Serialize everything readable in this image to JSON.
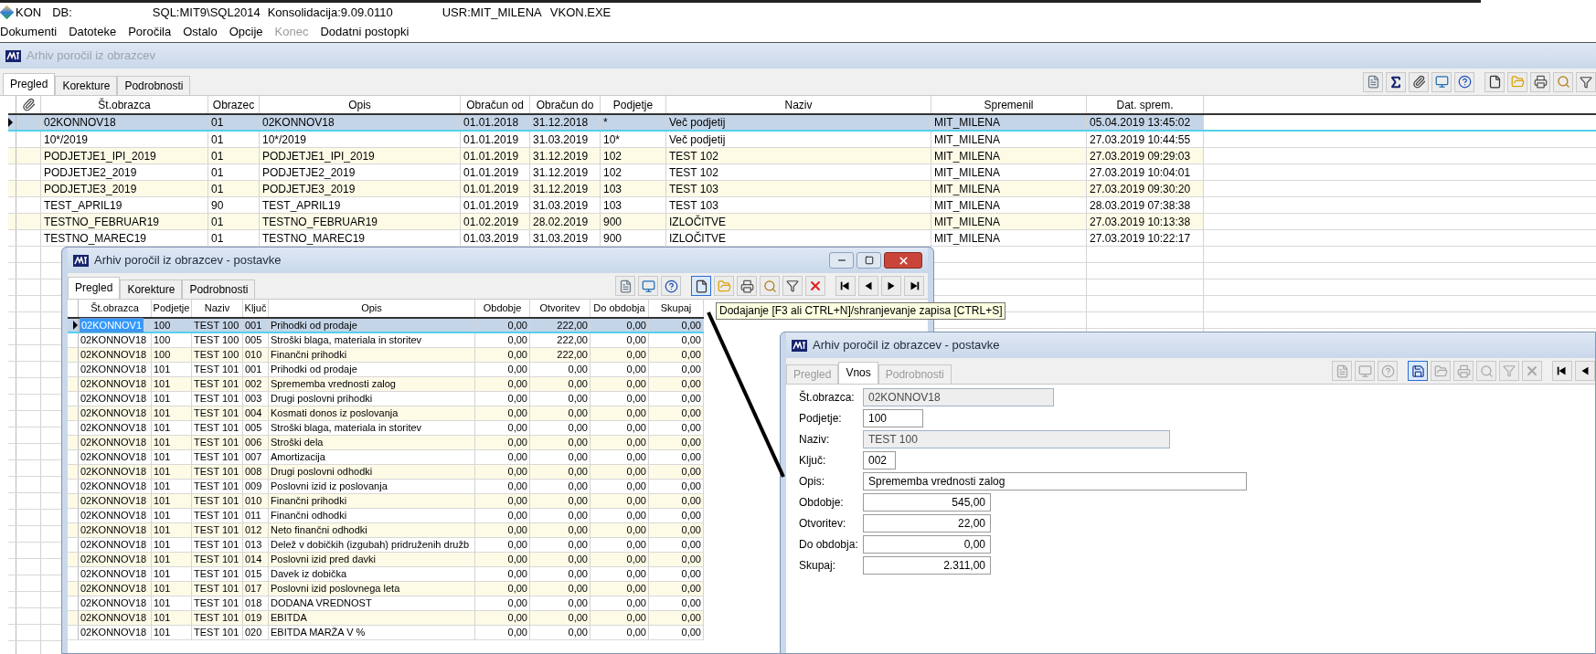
{
  "app_bar": {
    "app": "KON",
    "db": "DB:",
    "server": "SQL:MIT9\\SQL2014",
    "version": "Konsolidacija:9.09.0110",
    "user": "USR:MIT_MILENA",
    "exe": "VKON.EXE"
  },
  "menu": [
    {
      "label": "Dokumenti",
      "disabled": false
    },
    {
      "label": "Datoteke",
      "disabled": false
    },
    {
      "label": "Poročila",
      "disabled": false
    },
    {
      "label": "Ostalo",
      "disabled": false
    },
    {
      "label": "Opcije",
      "disabled": false
    },
    {
      "label": "Konec",
      "disabled": true
    },
    {
      "label": "Dodatni postopki",
      "disabled": false
    }
  ],
  "main_window": {
    "title": "Arhiv poročil iz obrazcev",
    "active": false,
    "tabs": [
      {
        "label": "Pregled",
        "selected": true
      },
      {
        "label": "Korekture",
        "selected": false
      },
      {
        "label": "Podrobnosti",
        "selected": false
      }
    ],
    "toolbar": [
      {
        "kind": "report"
      },
      {
        "kind": "sum"
      },
      {
        "kind": "attach"
      },
      {
        "kind": "monitor"
      },
      {
        "kind": "help"
      },
      {
        "kind": "new"
      },
      {
        "kind": "open"
      },
      {
        "kind": "print"
      },
      {
        "kind": "search"
      },
      {
        "kind": "filter"
      }
    ],
    "table": {
      "columns": [
        "Št.obrazca",
        "Obrazec",
        "Opis",
        "Obračun od",
        "Obračun do",
        "Podjetje",
        "Naziv",
        "Spremenil",
        "Dat. sprem."
      ],
      "rows": [
        {
          "selected": true,
          "cells": [
            "02KONNOV18",
            "01",
            "02KONNOV18",
            "01.01.2018",
            "31.12.2018",
            "*",
            "Več podjetij",
            "MIT_MILENA",
            "05.04.2019 13:45:02"
          ]
        },
        {
          "selected": false,
          "cells": [
            "10*/2019",
            "01",
            "10*/2019",
            "01.01.2019",
            "31.03.2019",
            "10*",
            "Več podjetij",
            "MIT_MILENA",
            "27.03.2019 10:44:55"
          ]
        },
        {
          "selected": false,
          "cells": [
            "PODJETJE1_IPI_2019",
            "01",
            "PODJETJE1_IPI_2019",
            "01.01.2019",
            "31.12.2019",
            "102",
            "TEST 102",
            "MIT_MILENA",
            "27.03.2019 09:29:03"
          ]
        },
        {
          "selected": false,
          "cells": [
            "PODJETJE2_2019",
            "01",
            "PODJETJE2_2019",
            "01.01.2019",
            "31.12.2019",
            "102",
            "TEST 102",
            "MIT_MILENA",
            "27.03.2019 10:04:01"
          ]
        },
        {
          "selected": false,
          "cells": [
            "PODJETJE3_2019",
            "01",
            "PODJETJE3_2019",
            "01.01.2019",
            "31.12.2019",
            "103",
            "TEST 103",
            "MIT_MILENA",
            "27.03.2019 09:30:20"
          ]
        },
        {
          "selected": false,
          "cells": [
            "TEST_APRIL19",
            "90",
            "TEST_APRIL19",
            "01.01.2019",
            "31.03.2019",
            "103",
            "TEST 103",
            "MIT_MILENA",
            "28.03.2019 07:38:38"
          ]
        },
        {
          "selected": false,
          "cells": [
            "TESTNO_FEBRUAR19",
            "01",
            "TESTNO_FEBRUAR19",
            "01.02.2019",
            "28.02.2019",
            "900",
            "IZLOČITVE",
            "MIT_MILENA",
            "27.03.2019 10:13:38"
          ]
        },
        {
          "selected": false,
          "cells": [
            "TESTNO_MAREC19",
            "01",
            "TESTNO_MAREC19",
            "01.03.2019",
            "31.03.2019",
            "900",
            "IZLOČITVE",
            "MIT_MILENA",
            "27.03.2019 10:22:17"
          ]
        }
      ]
    }
  },
  "detail_window": {
    "title": "Arhiv poročil iz obrazcev - postavke",
    "active": true,
    "tabs": [
      {
        "label": "Pregled",
        "selected": true
      },
      {
        "label": "Korekture",
        "selected": false
      },
      {
        "label": "Podrobnosti",
        "selected": false
      }
    ],
    "toolbar": [
      {
        "kind": "report",
        "highlighted": false
      },
      {
        "kind": "monitor",
        "highlighted": false
      },
      {
        "kind": "help",
        "highlighted": false
      },
      {
        "kind": "new",
        "highlighted": true
      },
      {
        "kind": "open",
        "highlighted": false
      },
      {
        "kind": "print",
        "highlighted": false
      },
      {
        "kind": "search",
        "highlighted": false
      },
      {
        "kind": "filter",
        "highlighted": false
      },
      {
        "kind": "delete",
        "highlighted": false
      },
      {
        "kind": "first",
        "highlighted": false
      },
      {
        "kind": "prev",
        "highlighted": false
      },
      {
        "kind": "next",
        "highlighted": false
      },
      {
        "kind": "last",
        "highlighted": false
      }
    ],
    "tooltip": "Dodajanje [F3 ali CTRL+N]/shranjevanje zapisa [CTRL+S]",
    "table": {
      "columns": [
        "Št.obrazca",
        "Podjetje",
        "Naziv",
        "Ključ",
        "Opis",
        "Obdobje",
        "Otvoritev",
        "Do obdobja",
        "Skupaj"
      ],
      "rows": [
        {
          "selected": true,
          "editing": true,
          "cells": [
            "02KONNOV1",
            "100",
            "TEST 100",
            "001",
            "Prihodki od prodaje",
            "0,00",
            "222,00",
            "0,00",
            "0,00"
          ]
        },
        {
          "selected": false,
          "editing": false,
          "cells": [
            "02KONNOV18",
            "100",
            "TEST 100",
            "005",
            "Stroški blaga, materiala in storitev",
            "0,00",
            "222,00",
            "0,00",
            "0,00"
          ]
        },
        {
          "selected": false,
          "editing": false,
          "cells": [
            "02KONNOV18",
            "100",
            "TEST 100",
            "010",
            "Finančni prihodki",
            "0,00",
            "222,00",
            "0,00",
            "0,00"
          ]
        },
        {
          "selected": false,
          "editing": false,
          "cells": [
            "02KONNOV18",
            "101",
            "TEST 101",
            "001",
            "Prihodki od prodaje",
            "0,00",
            "0,00",
            "0,00",
            "0,00"
          ]
        },
        {
          "selected": false,
          "editing": false,
          "cells": [
            "02KONNOV18",
            "101",
            "TEST 101",
            "002",
            "Sprememba vrednosti zalog",
            "0,00",
            "0,00",
            "0,00",
            "0,00"
          ]
        },
        {
          "selected": false,
          "editing": false,
          "cells": [
            "02KONNOV18",
            "101",
            "TEST 101",
            "003",
            "Drugi poslovni prihodki",
            "0,00",
            "0,00",
            "0,00",
            "0,00"
          ]
        },
        {
          "selected": false,
          "editing": false,
          "cells": [
            "02KONNOV18",
            "101",
            "TEST 101",
            "004",
            "Kosmati donos iz poslovanja",
            "0,00",
            "0,00",
            "0,00",
            "0,00"
          ]
        },
        {
          "selected": false,
          "editing": false,
          "cells": [
            "02KONNOV18",
            "101",
            "TEST 101",
            "005",
            "Stroški blaga, materiala in storitev",
            "0,00",
            "0,00",
            "0,00",
            "0,00"
          ]
        },
        {
          "selected": false,
          "editing": false,
          "cells": [
            "02KONNOV18",
            "101",
            "TEST 101",
            "006",
            "Stroški dela",
            "0,00",
            "0,00",
            "0,00",
            "0,00"
          ]
        },
        {
          "selected": false,
          "editing": false,
          "cells": [
            "02KONNOV18",
            "101",
            "TEST 101",
            "007",
            "Amortizacija",
            "0,00",
            "0,00",
            "0,00",
            "0,00"
          ]
        },
        {
          "selected": false,
          "editing": false,
          "cells": [
            "02KONNOV18",
            "101",
            "TEST 101",
            "008",
            "Drugi poslovni odhodki",
            "0,00",
            "0,00",
            "0,00",
            "0,00"
          ]
        },
        {
          "selected": false,
          "editing": false,
          "cells": [
            "02KONNOV18",
            "101",
            "TEST 101",
            "009",
            "Poslovni izid iz poslovanja",
            "0,00",
            "0,00",
            "0,00",
            "0,00"
          ]
        },
        {
          "selected": false,
          "editing": false,
          "cells": [
            "02KONNOV18",
            "101",
            "TEST 101",
            "010",
            "Finančni prihodki",
            "0,00",
            "0,00",
            "0,00",
            "0,00"
          ]
        },
        {
          "selected": false,
          "editing": false,
          "cells": [
            "02KONNOV18",
            "101",
            "TEST 101",
            "011",
            "Finančni odhodki",
            "0,00",
            "0,00",
            "0,00",
            "0,00"
          ]
        },
        {
          "selected": false,
          "editing": false,
          "cells": [
            "02KONNOV18",
            "101",
            "TEST 101",
            "012",
            "Neto finančni odhodki",
            "0,00",
            "0,00",
            "0,00",
            "0,00"
          ]
        },
        {
          "selected": false,
          "editing": false,
          "cells": [
            "02KONNOV18",
            "101",
            "TEST 101",
            "013",
            "Delež v dobičkih (izgubah) pridruženih družb",
            "0,00",
            "0,00",
            "0,00",
            "0,00"
          ]
        },
        {
          "selected": false,
          "editing": false,
          "cells": [
            "02KONNOV18",
            "101",
            "TEST 101",
            "014",
            "Poslovni izid pred davki",
            "0,00",
            "0,00",
            "0,00",
            "0,00"
          ]
        },
        {
          "selected": false,
          "editing": false,
          "cells": [
            "02KONNOV18",
            "101",
            "TEST 101",
            "015",
            "Davek iz dobička",
            "0,00",
            "0,00",
            "0,00",
            "0,00"
          ]
        },
        {
          "selected": false,
          "editing": false,
          "cells": [
            "02KONNOV18",
            "101",
            "TEST 101",
            "017",
            "Poslovni izid poslovnega leta",
            "0,00",
            "0,00",
            "0,00",
            "0,00"
          ]
        },
        {
          "selected": false,
          "editing": false,
          "cells": [
            "02KONNOV18",
            "101",
            "TEST 101",
            "018",
            "DODANA VREDNOST",
            "0,00",
            "0,00",
            "0,00",
            "0,00"
          ]
        },
        {
          "selected": false,
          "editing": false,
          "cells": [
            "02KONNOV18",
            "101",
            "TEST 101",
            "019",
            "EBITDA",
            "0,00",
            "0,00",
            "0,00",
            "0,00"
          ]
        },
        {
          "selected": false,
          "editing": false,
          "cells": [
            "02KONNOV18",
            "101",
            "TEST 101",
            "020",
            "EBITDA MARŽA V %",
            "0,00",
            "0,00",
            "0,00",
            "0,00"
          ]
        }
      ]
    }
  },
  "entry_window": {
    "title": "Arhiv poročil iz obrazcev - postavke",
    "active": true,
    "tabs": [
      {
        "label": "Pregled",
        "selected": false,
        "disabled": true
      },
      {
        "label": "Vnos",
        "selected": true,
        "disabled": false
      },
      {
        "label": "Podrobnosti",
        "selected": false,
        "disabled": true
      }
    ],
    "toolbar": [
      {
        "kind": "report",
        "highlighted": false
      },
      {
        "kind": "monitor",
        "highlighted": false
      },
      {
        "kind": "help",
        "highlighted": false
      },
      {
        "kind": "save",
        "highlighted": true
      },
      {
        "kind": "open",
        "highlighted": false
      },
      {
        "kind": "print",
        "highlighted": false
      },
      {
        "kind": "search",
        "highlighted": false
      },
      {
        "kind": "filter",
        "highlighted": false
      },
      {
        "kind": "delete",
        "highlighted": false
      },
      {
        "kind": "first",
        "highlighted": false
      },
      {
        "kind": "prev",
        "highlighted": false
      }
    ],
    "fields": [
      {
        "label": "Št.obrazca:",
        "value": "02KONNOV18",
        "kind": "wide",
        "readonly": true
      },
      {
        "label": "Podjetje:",
        "value": "100",
        "kind": "short",
        "readonly": false
      },
      {
        "label": "Naziv:",
        "value": "TEST 100",
        "kind": "long",
        "readonly": true
      },
      {
        "label": "Ključ:",
        "value": "002",
        "kind": "tiny",
        "readonly": false
      },
      {
        "label": "Opis:",
        "value": "Sprememba vrednosti zalog",
        "kind": "text",
        "readonly": false
      },
      {
        "label": "Obdobje:",
        "value": "545,00",
        "kind": "number",
        "readonly": false
      },
      {
        "label": "Otvoritev:",
        "value": "22,00",
        "kind": "number",
        "readonly": false
      },
      {
        "label": "Do obdobja:",
        "value": "0,00",
        "kind": "number",
        "readonly": false
      },
      {
        "label": "Skupaj:",
        "value": "2.311,00",
        "kind": "number",
        "readonly": false
      }
    ]
  }
}
